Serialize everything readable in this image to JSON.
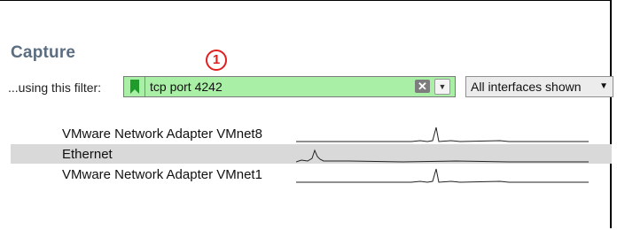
{
  "capture": {
    "title": "Capture",
    "annotation_badge": "1",
    "filter_label": "...using this filter:",
    "filter_value": "tcp port 4242",
    "filter_state_color": "#a9f0a6",
    "bookmark_icon": "bookmark-icon",
    "clear_icon": "clear-filter-icon",
    "history_icon": "chevron-down-icon",
    "interfaces_dropdown_label": "All interfaces shown",
    "interfaces": [
      {
        "name": "VMware Network Adapter VMnet8",
        "selected": false
      },
      {
        "name": "Ethernet",
        "selected": true
      },
      {
        "name": "VMware Network Adapter VMnet1",
        "selected": false
      }
    ]
  }
}
